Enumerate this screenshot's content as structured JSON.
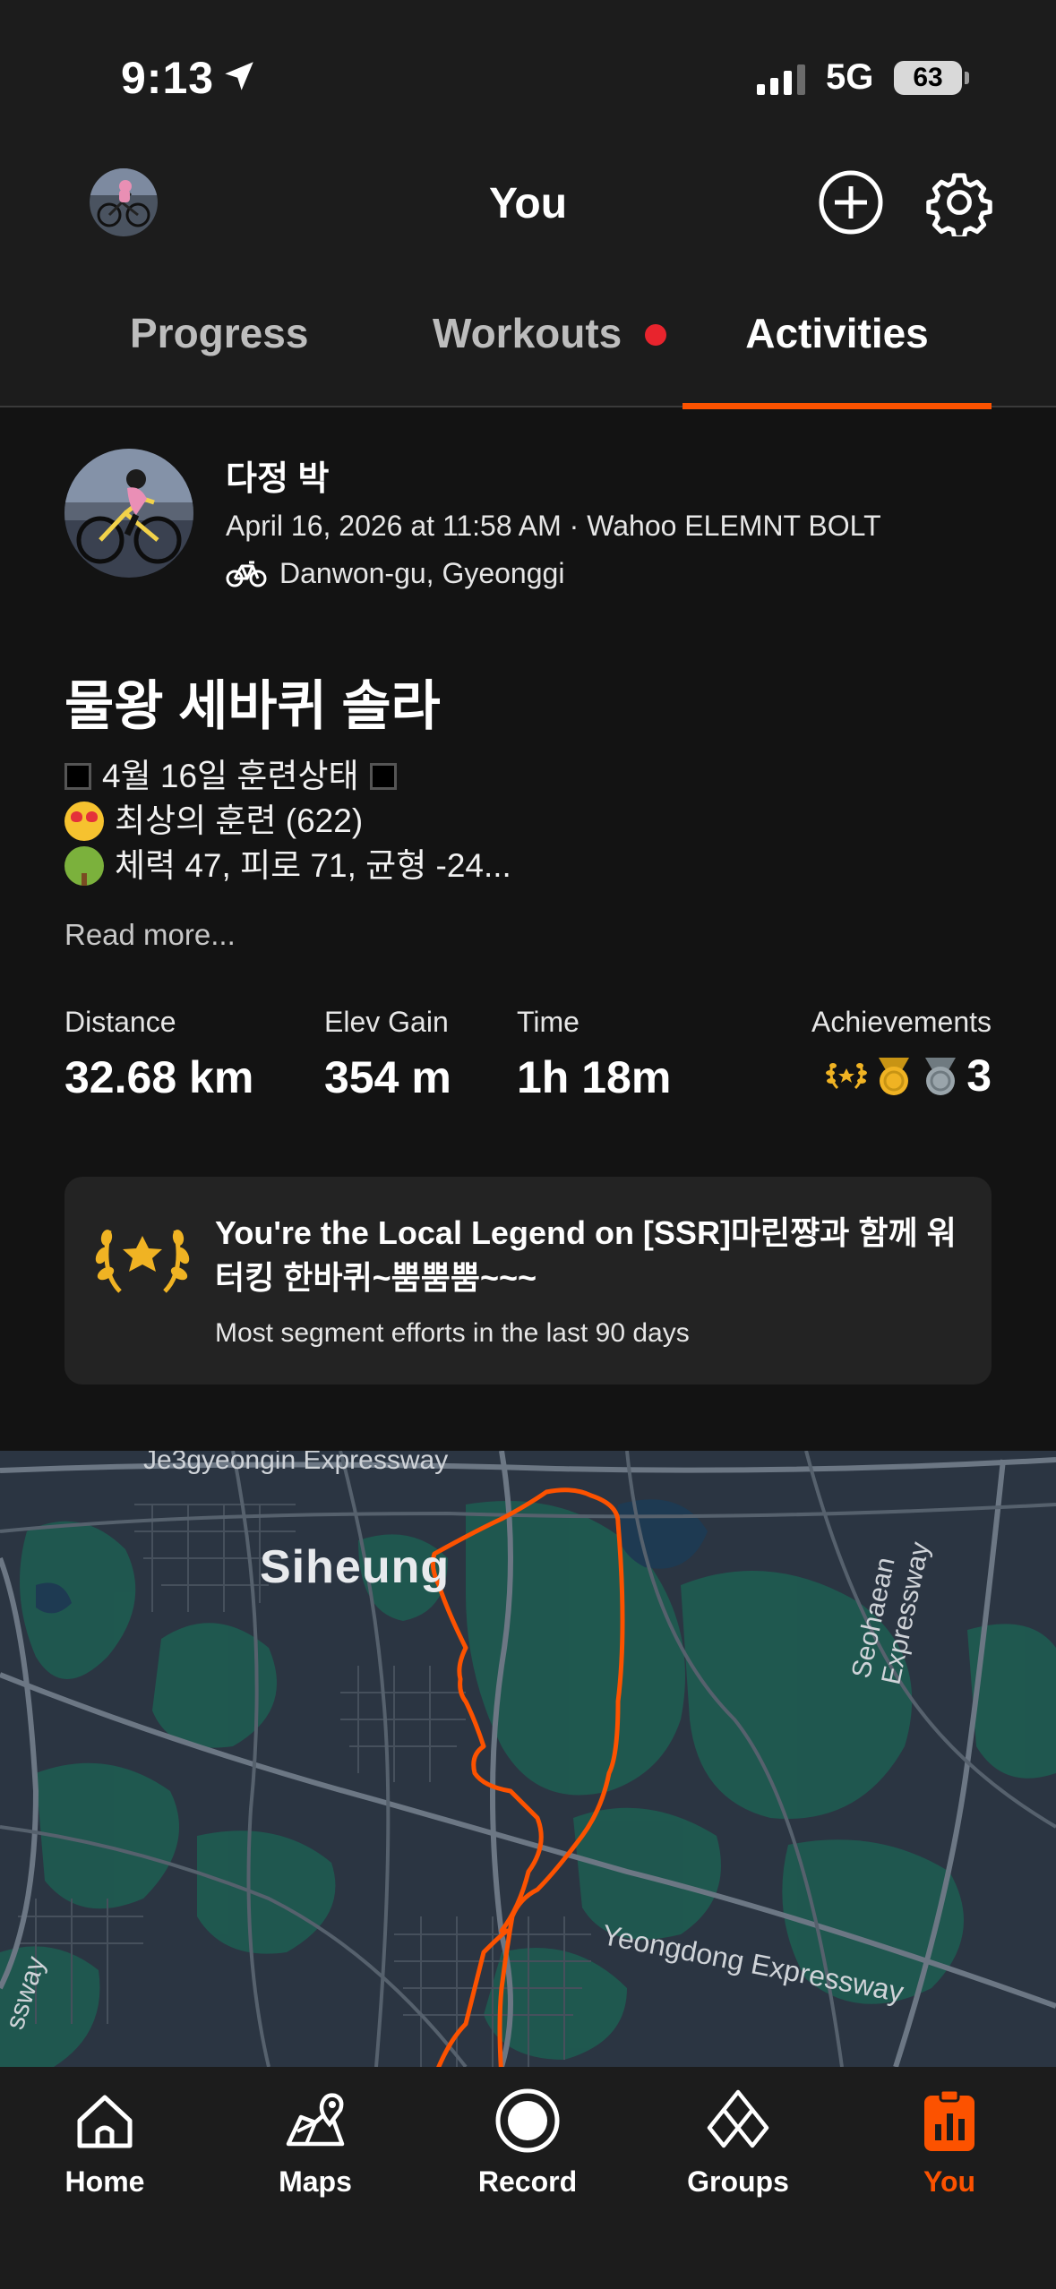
{
  "status_bar": {
    "time": "9:13",
    "network": "5G",
    "battery": "63"
  },
  "header": {
    "title": "You"
  },
  "tabs": [
    {
      "label": "Progress"
    },
    {
      "label": "Workouts",
      "has_notification": true
    },
    {
      "label": "Activities",
      "active": true
    }
  ],
  "activity": {
    "athlete_name": "다정 박",
    "meta": "April 16, 2026 at 11:58 AM · Wahoo ELEMNT BOLT",
    "location": "Danwon-gu, Gyeonggi",
    "title": "물왕 세바퀴 솔라",
    "description": [
      "4월 16일 훈련상태",
      "최상의 훈련 (622)",
      "체력 47, 피로 71, 균형 -24..."
    ],
    "read_more": "Read more...",
    "stats": [
      {
        "label": "Distance",
        "value": "32.68 km"
      },
      {
        "label": "Elev Gain",
        "value": "354 m"
      },
      {
        "label": "Time",
        "value": "1h 18m"
      }
    ],
    "achievements": {
      "label": "Achievements",
      "count": "3"
    },
    "local_legend": {
      "title": "You're the Local Legend on [SSR]마린쨩과 함께 워터킹 한바퀴~뿜뿜뿜~~~",
      "subtitle": "Most segment efforts in the last 90 days"
    }
  },
  "map": {
    "labels": {
      "city": "Siheung",
      "expressway_top": "Je3gyeongin Expressway",
      "expressway_right": "Seohaean Expressway",
      "expressway_bottom": "Yeongdong Expressway",
      "expressway_left": "ssway"
    },
    "route_color": "#fc5200"
  },
  "tabbar": {
    "items": [
      {
        "label": "Home",
        "icon": "home-icon"
      },
      {
        "label": "Maps",
        "icon": "maps-icon"
      },
      {
        "label": "Record",
        "icon": "record-icon"
      },
      {
        "label": "Groups",
        "icon": "groups-icon"
      },
      {
        "label": "You",
        "icon": "you-icon",
        "active": true
      }
    ]
  },
  "colors": {
    "accent": "#fc5200",
    "background": "#131313",
    "surface": "#1c1c1c",
    "card": "#232323",
    "notification": "#e8242d"
  }
}
